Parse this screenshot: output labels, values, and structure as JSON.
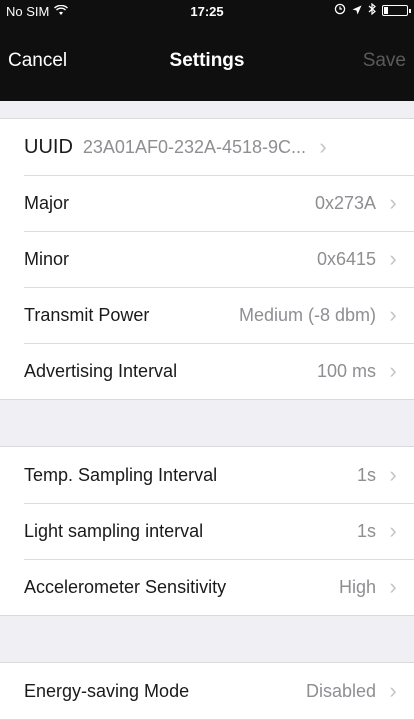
{
  "status": {
    "carrier": "No SIM",
    "time": "17:25"
  },
  "nav": {
    "cancel": "Cancel",
    "title": "Settings",
    "save": "Save"
  },
  "group1": [
    {
      "label": "UUID",
      "value": "23A01AF0-232A-4518-9C..."
    },
    {
      "label": "Major",
      "value": "0x273A"
    },
    {
      "label": "Minor",
      "value": "0x6415"
    },
    {
      "label": "Transmit Power",
      "value": "Medium (-8 dbm)"
    },
    {
      "label": "Advertising Interval",
      "value": "100 ms"
    }
  ],
  "group2": [
    {
      "label": "Temp. Sampling Interval",
      "value": "1s"
    },
    {
      "label": "Light sampling interval",
      "value": "1s"
    },
    {
      "label": "Accelerometer Sensitivity",
      "value": "High"
    }
  ],
  "group3": [
    {
      "label": "Energy-saving Mode",
      "value": "Disabled"
    }
  ],
  "icons": {
    "wifi": "wifi-icon",
    "alarm": "alarm-icon",
    "location": "location-arrow-icon",
    "bluetooth": "bluetooth-icon",
    "battery": "battery-icon",
    "chevron": "chevron-right-icon"
  },
  "colors": {
    "topbar": "#0f0f0f",
    "background": "#efeff4",
    "value_text": "#8e8e93",
    "save_disabled": "#5a5a5a"
  }
}
